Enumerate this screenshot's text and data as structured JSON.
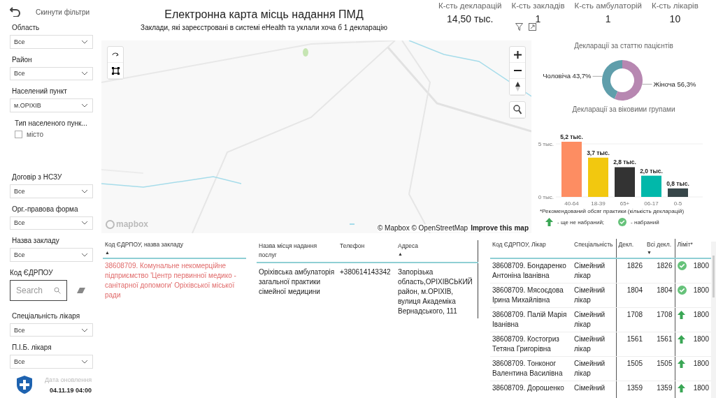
{
  "sidebar": {
    "reset": "Скинути фільтри",
    "filters": [
      {
        "kind": "dropdown",
        "label": "Область",
        "value": "Все"
      },
      {
        "kind": "dropdown",
        "label": "Район",
        "value": "Все"
      },
      {
        "kind": "dropdown",
        "label": "Населений пункт",
        "value": "м.ОРІХІВ"
      },
      {
        "kind": "checkbox",
        "label": "Тип населеного пунк...",
        "option": "місто",
        "checked": false
      },
      {
        "kind": "dropdown",
        "label": "Договір з НСЗУ",
        "value": "Все"
      },
      {
        "kind": "dropdown",
        "label": "Орг.-правова форма",
        "value": "Все"
      },
      {
        "kind": "dropdown",
        "label": "Назва закладу",
        "value": "Все"
      },
      {
        "kind": "search",
        "label": "Код ЄДРПОУ",
        "placeholder": "Search"
      },
      {
        "kind": "dropdown",
        "label": "Спеціальність лікаря",
        "value": "Все"
      },
      {
        "kind": "dropdown",
        "label": "П.І.Б. лікаря",
        "value": "Все"
      }
    ],
    "update_label": "Дата оновлення",
    "update_value": "04.11.19 04:00"
  },
  "header": {
    "title": "Електронна карта місць надання ПМД",
    "subtitle": "Заклади, які зареєстровані в системі eHealth та уклали хоча б 1 декларацію"
  },
  "kpis": [
    {
      "label": "К-сть декларацій",
      "value": "14,50 тыс."
    },
    {
      "label": "К-сть закладів",
      "value": "1"
    },
    {
      "label": "К-сть амбулаторій",
      "value": "1"
    },
    {
      "label": "К-сть лікарів",
      "value": "10"
    }
  ],
  "map": {
    "kind": "picture",
    "logo": "mapbox",
    "attribution": "© Mapbox © OpenStreetMap",
    "improve_link": "Improve this map"
  },
  "gender_chart": {
    "chart_data": {
      "type": "donut",
      "title": "Декларації за статтю пацієнтів",
      "categories": [
        "Чоловіча",
        "Жіноча"
      ],
      "values": [
        43.7,
        56.3
      ],
      "value_labels": [
        "43,7%",
        "56,3%"
      ],
      "colors": [
        "#5f9eab",
        "#b787b1"
      ]
    }
  },
  "age_chart": {
    "chart_data": {
      "type": "bar",
      "title": "Декларації за віковими групами",
      "categories": [
        "40-64",
        "18-39",
        "65+",
        "06-17",
        "0-5"
      ],
      "values": [
        5.2,
        3.7,
        2.8,
        2.0,
        0.8
      ],
      "colors": [
        "#fd8d62",
        "#f2c80f",
        "#333333",
        "#01b8aa",
        "#374649"
      ],
      "ylim": [
        0,
        5.2
      ],
      "yticks": [
        {
          "value": 0,
          "label": "0 тыс."
        },
        {
          "value": 5,
          "label": "5 тыс."
        }
      ],
      "value_labels": [
        "5,2 тыс.",
        "3,7 тыс.",
        "2,8 тыс.",
        "2,0 тыс.",
        "0,8 тыс."
      ]
    }
  },
  "legend": {
    "note": "*Рекомендований обсяг практики (кількість декларацій)",
    "not_reached": "- ще не набраний;",
    "reached": "- набраний"
  },
  "institutions": {
    "column": "Код ЄДРПОУ, назва закладу",
    "sort": "▲",
    "rows": [
      "38608709. Комунальне некомерційне підприємство 'Центр первинної медико - санітарної допомоги' Оріхівської міської ради"
    ]
  },
  "places": {
    "columns": [
      {
        "label": "Назва місця надання послуг"
      },
      {
        "label": "Телефон"
      },
      {
        "label": "Адреса",
        "sort": "▲"
      }
    ],
    "rows": [
      [
        "Оріхівська амбулаторія загальної практики сімейної медицини",
        "+380614143342",
        "Запорізька область,ОРІХІВСЬКИЙ район, м.ОРІХІВ, вулиця Академіка Вернадського, 111"
      ]
    ]
  },
  "doctors": {
    "columns": [
      {
        "label": "Код ЄДРПОУ, Лікар"
      },
      {
        "label": "Спеціальність"
      },
      {
        "label": "Декл."
      },
      {
        "label": "Всі декл.",
        "sort": "▼"
      },
      {
        "label": "Ліміт*"
      }
    ],
    "rows": [
      {
        "name": "38608709. Бондаренко Антоніна Іванівна",
        "specialty": "Сімейний лікар",
        "decl": "1826",
        "all": "1826",
        "limit_reached": true,
        "limit": "1800"
      },
      {
        "name": "38608709. Мясоєдова Ірина Михайлівна",
        "specialty": "Сімейний лікар",
        "decl": "1804",
        "all": "1804",
        "limit_reached": true,
        "limit": "1800"
      },
      {
        "name": "38608709. Палій Марія Іванівна",
        "specialty": "Сімейний лікар",
        "decl": "1708",
        "all": "1708",
        "limit_reached": false,
        "limit": "1800"
      },
      {
        "name": "38608709. Костогриз Тетяна Григорівна",
        "specialty": "Сімейний лікар",
        "decl": "1561",
        "all": "1561",
        "limit_reached": false,
        "limit": "1800"
      },
      {
        "name": "38608709. Тонконог Валентина Василівна",
        "specialty": "Сімейний лікар",
        "decl": "1505",
        "all": "1505",
        "limit_reached": false,
        "limit": "1800"
      },
      {
        "name": "38608709. Дорошенко",
        "specialty": "Сімейний",
        "decl": "1359",
        "all": "1359",
        "limit_reached": false,
        "limit": "1800"
      }
    ]
  }
}
